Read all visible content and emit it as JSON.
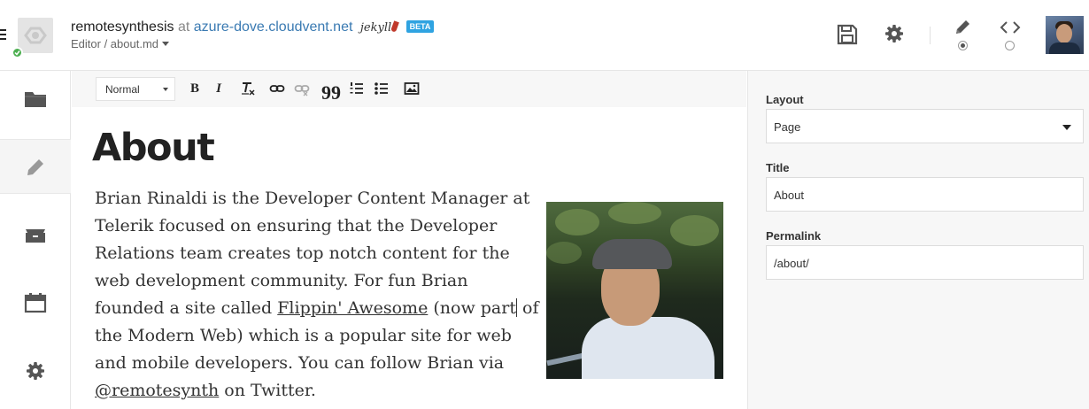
{
  "header": {
    "site_name": "remotesynthesis",
    "at_text": "at",
    "host": "azure-dove.cloudvent.net",
    "generator": "jekyll",
    "badge": "BETA",
    "breadcrumb": "Editor / about.md",
    "icons": {
      "menu": "hamburger-icon",
      "site": "site-logo-icon",
      "status": "check-icon",
      "save": "floppy-disk-icon",
      "settings": "gear-icon",
      "visual": "pencil-icon",
      "source": "code-icon"
    },
    "mode": "visual"
  },
  "sidebar": {
    "items": [
      {
        "name": "files",
        "icon": "folder-icon"
      },
      {
        "name": "editor",
        "icon": "pencil-icon",
        "active": true
      },
      {
        "name": "collections",
        "icon": "archive-icon"
      },
      {
        "name": "posts",
        "icon": "calendar-icon"
      },
      {
        "name": "settings",
        "icon": "gear-icon"
      }
    ]
  },
  "toolbar": {
    "format": "Normal",
    "buttons": [
      "bold",
      "italic",
      "clear-format",
      "link",
      "unlink",
      "blockquote",
      "ordered-list",
      "bullet-list",
      "image"
    ],
    "bold_label": "B",
    "italic_label": "I",
    "quote_label": "99"
  },
  "content": {
    "title": "About",
    "p1": "Brian Rinaldi is the Developer Content Manager at Telerik focused on ensuring that the Developer Relations team creates top notch content for the web development community. For fun Brian founded a site called ",
    "link1": "Flippin' Awesome",
    "p2a": " (now part",
    "p2b": " of the Modern Web) which is a popular site for web and mobile developers. You can follow Brian via ",
    "link2": "@remotesynth",
    "p3": " on Twitter."
  },
  "meta": {
    "layout_label": "Layout",
    "layout_value": "Page",
    "title_label": "Title",
    "title_value": "About",
    "permalink_label": "Permalink",
    "permalink_value": "/about/"
  }
}
